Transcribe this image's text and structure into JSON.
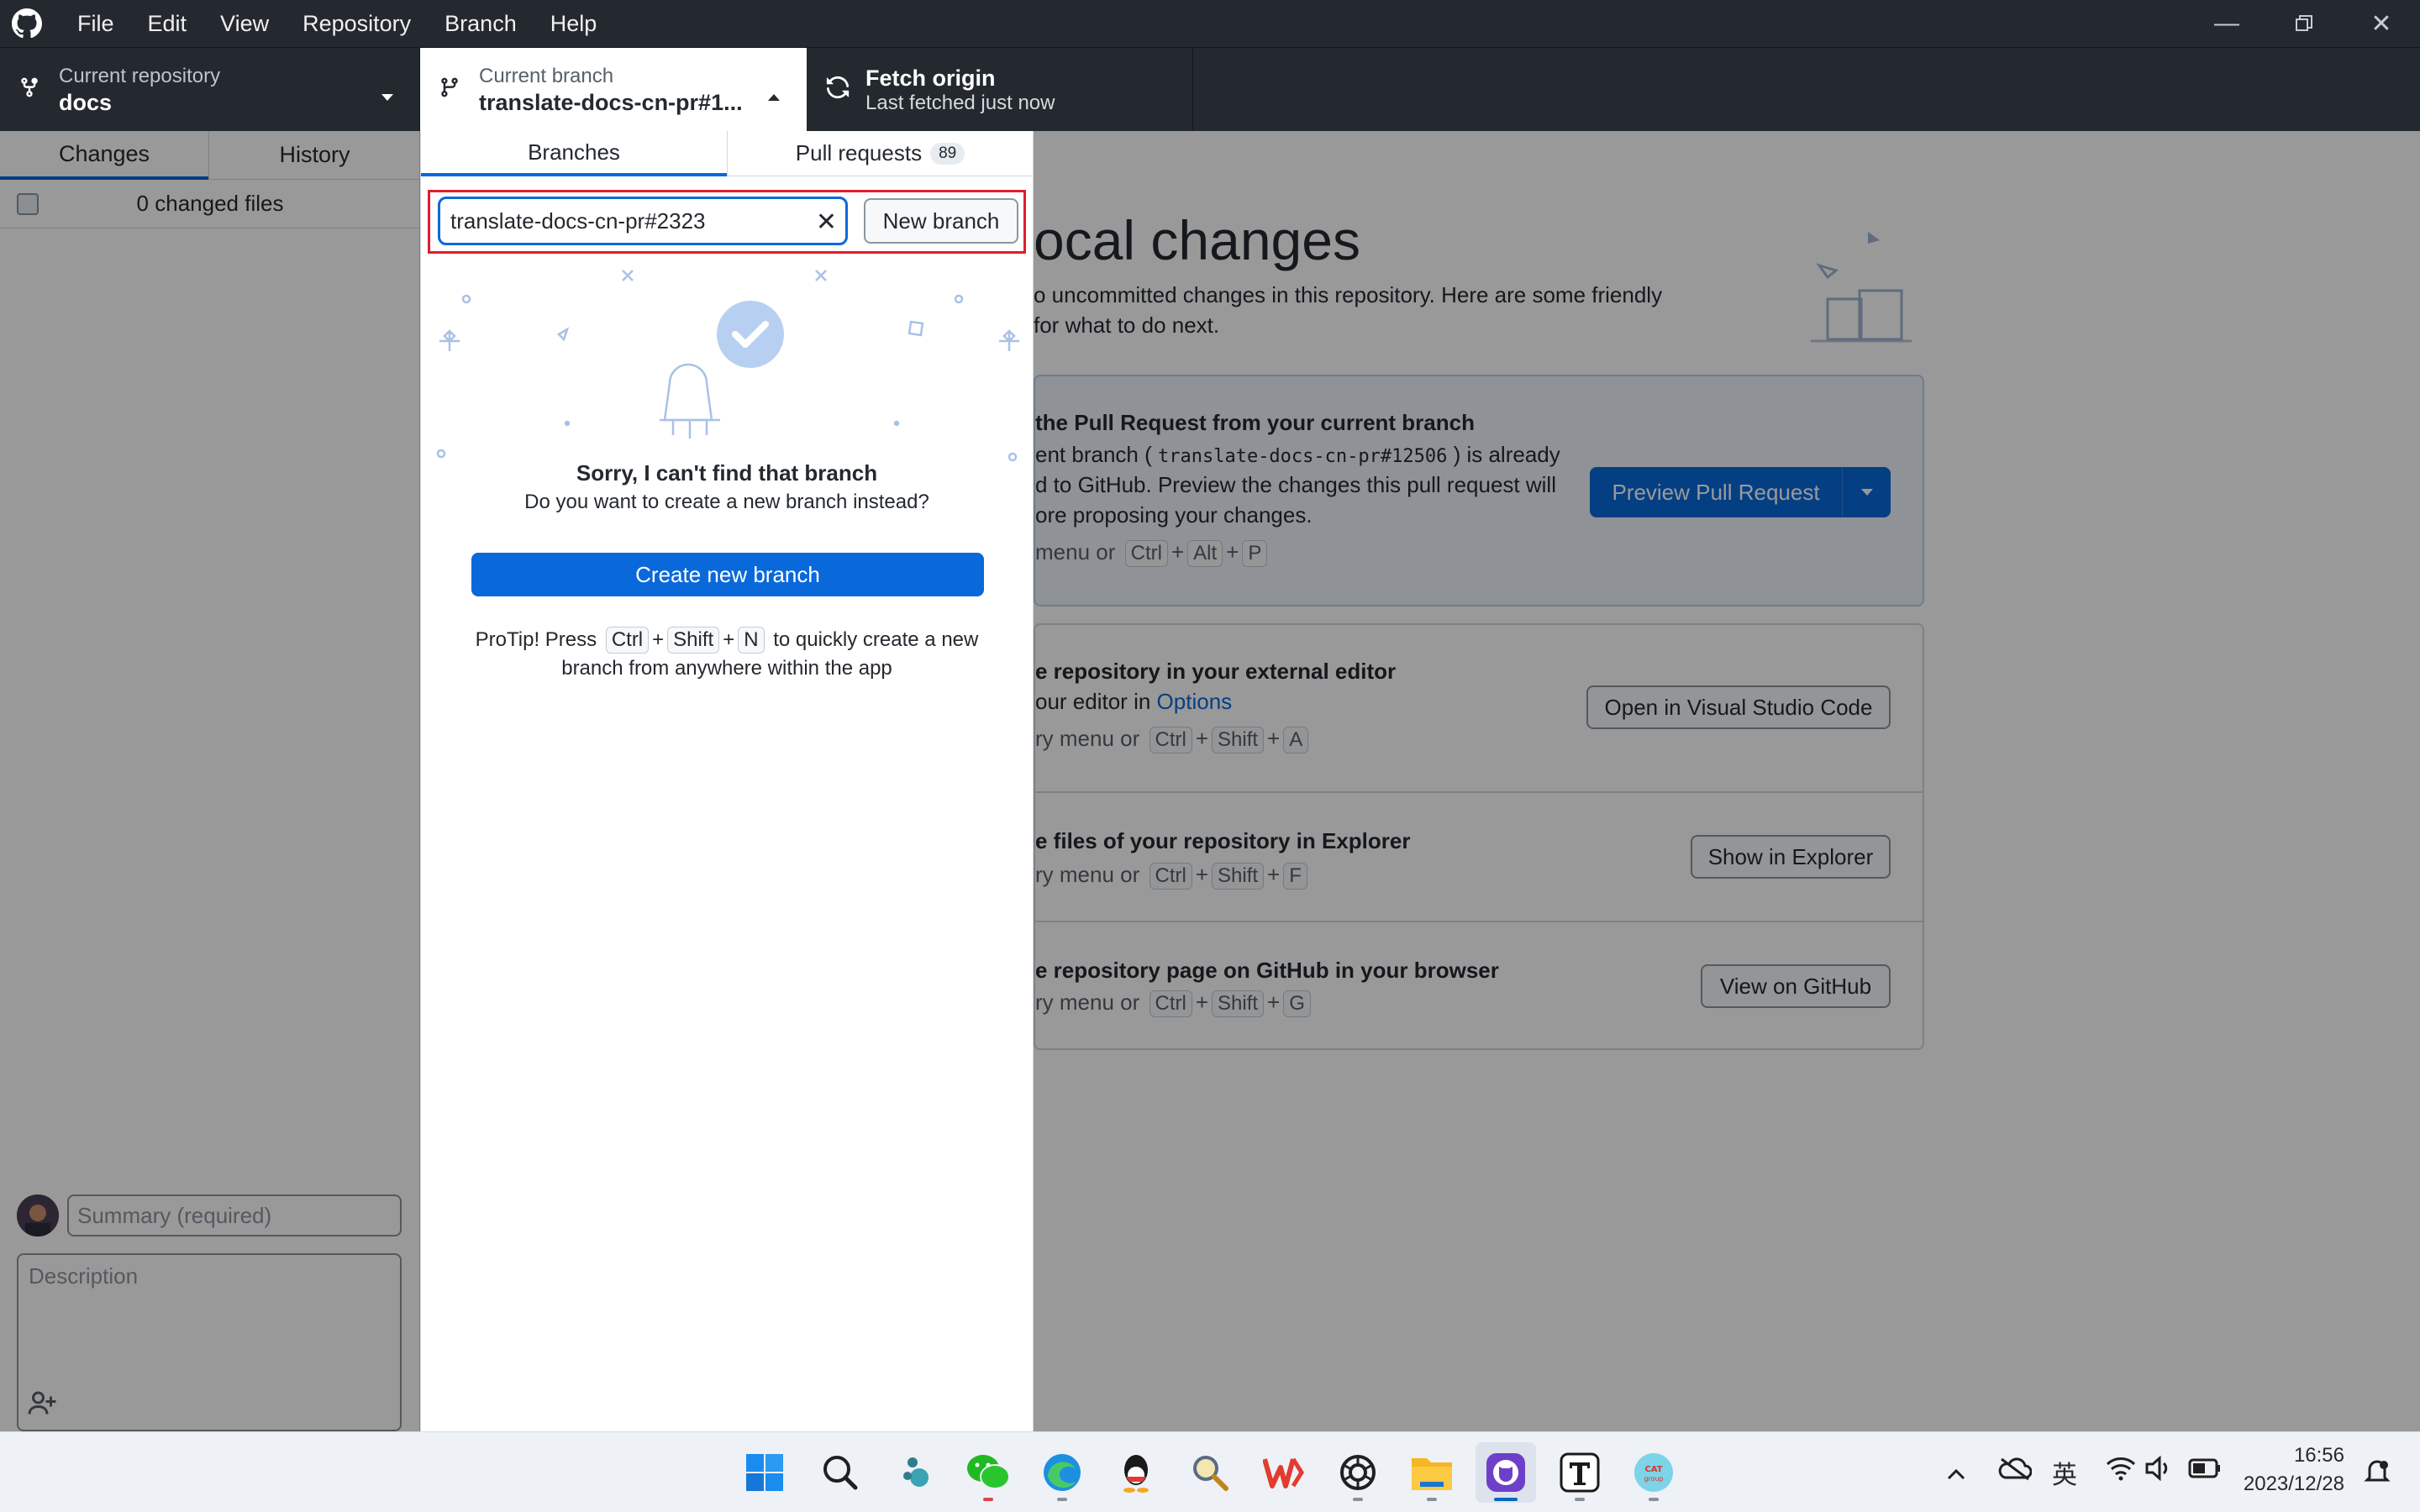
{
  "menu": [
    "File",
    "Edit",
    "View",
    "Repository",
    "Branch",
    "Help"
  ],
  "toolbar": {
    "repo_label": "Current repository",
    "repo_value": "docs",
    "branch_label": "Current branch",
    "branch_value": "translate-docs-cn-pr#1...",
    "fetch_title": "Fetch origin",
    "fetch_sub": "Last fetched just now"
  },
  "left": {
    "tab_changes": "Changes",
    "tab_history": "History",
    "changed_files": "0 changed files",
    "summary_placeholder": "Summary (required)",
    "description_placeholder": "Description"
  },
  "dropdown": {
    "tab_branches": "Branches",
    "tab_pulls": "Pull requests",
    "pulls_count": "89",
    "filter_value": "translate-docs-cn-pr#2323",
    "new_branch": "New branch",
    "empty_title": "Sorry, I can't find that branch",
    "empty_sub": "Do you want to create a new branch instead?",
    "create_button": "Create new branch",
    "protip_pre": "ProTip! Press",
    "protip_k1": "Ctrl",
    "protip_k2": "Shift",
    "protip_k3": "N",
    "protip_post": "to quickly create a new",
    "protip_line2": "branch from anywhere within the app"
  },
  "welcome": {
    "heading": "ocal changes",
    "sub1": "o uncommitted changes in this repository. Here are some friendly",
    "sub2": "for what to do next.",
    "pr_title": "the Pull Request from your current branch",
    "pr_line1_a": "ent branch (",
    "pr_line1_code": "translate-docs-cn-pr#12506",
    "pr_line1_b": ") is already",
    "pr_line2": "d to GitHub. Preview the changes this pull request will",
    "pr_line3": "ore proposing your changes.",
    "pr_line4": "menu or",
    "pr_keys": [
      "Ctrl",
      "Alt",
      "P"
    ],
    "pr_button": "Preview Pull Request",
    "ed_title": "e repository in your external editor",
    "ed_line1": "our editor in",
    "ed_link": "Options",
    "ed_line2": "ry menu or",
    "ed_keys": [
      "Ctrl",
      "Shift",
      "A"
    ],
    "ed_button": "Open in Visual Studio Code",
    "ex_title": "e files of your repository in Explorer",
    "ex_line": "ry menu or",
    "ex_keys": [
      "Ctrl",
      "Shift",
      "F"
    ],
    "ex_button": "Show in Explorer",
    "gh_title": "e repository page on GitHub in your browser",
    "gh_line": "ry menu or",
    "gh_keys": [
      "Ctrl",
      "Shift",
      "G"
    ],
    "gh_button": "View on GitHub"
  },
  "tray": {
    "ime": "英",
    "time": "16:56",
    "date": "2023/12/28"
  },
  "colors": {
    "titlebar": "#24292f",
    "accent_blue": "#0969da",
    "highlight_red": "#e11d2b"
  }
}
